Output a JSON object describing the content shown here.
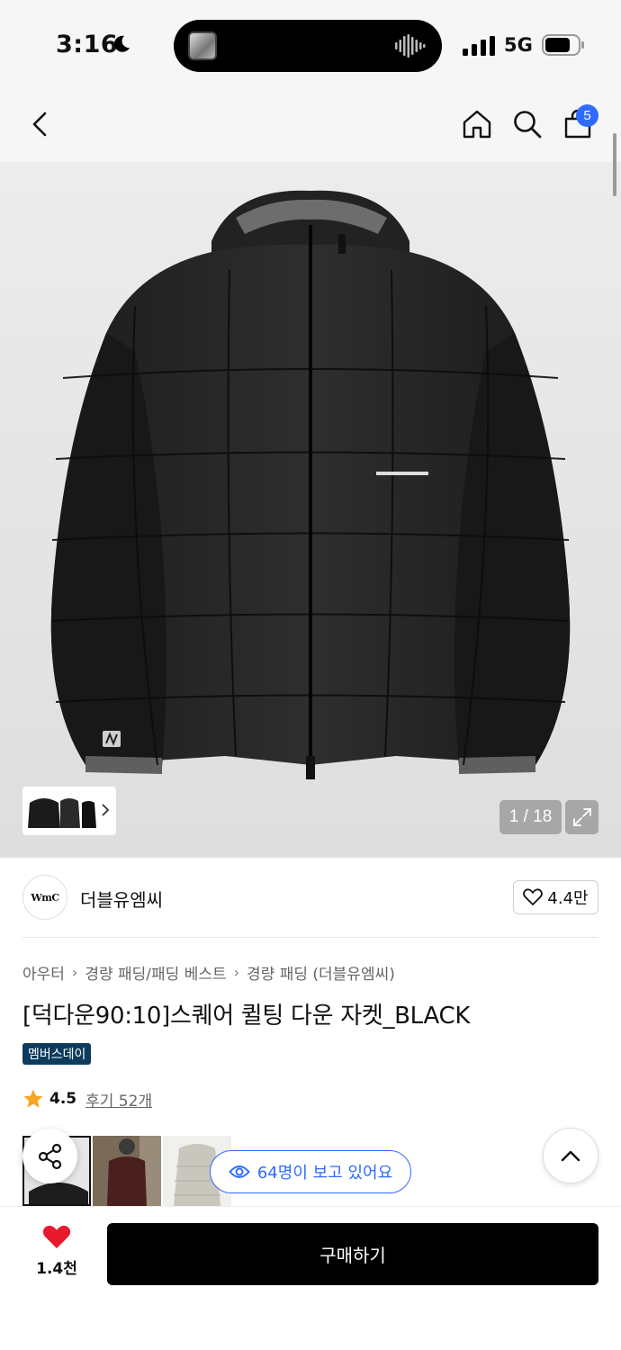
{
  "status_bar": {
    "time": "3:16",
    "network": "5G"
  },
  "nav": {
    "cart_count": "5"
  },
  "gallery": {
    "counter": "1 / 18"
  },
  "brand": {
    "logo_text": "WmC",
    "name": "더블유엠씨",
    "likes": "4.4만"
  },
  "breadcrumb": [
    "아우터",
    "경량 패딩/패딩 베스트",
    "경량 패딩 (더블유엠씨)"
  ],
  "product": {
    "title": "[덕다운90:10]스퀘어 퀼팅 다운 자켓_BLACK",
    "tag": "멤버스데이",
    "rating": "4.5",
    "reviews": "후기 52개"
  },
  "viewers": "64명이 보고 있어요",
  "bottom": {
    "wish_count": "1.4천",
    "buy_label": "구매하기"
  },
  "colors": {
    "accent_blue": "#2f6bff",
    "heart_red": "#e8192c",
    "tag_navy": "#0d3b5e",
    "star": "#f5a623"
  }
}
